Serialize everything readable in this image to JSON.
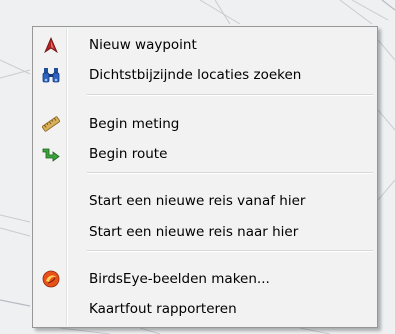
{
  "menu": {
    "items": [
      {
        "label": "Nieuw waypoint",
        "icon": "waypoint-pin-icon"
      },
      {
        "label": "Dichtstbijzijnde locaties zoeken",
        "icon": "binoculars-icon"
      },
      {
        "label": "Begin meting",
        "icon": "ruler-icon"
      },
      {
        "label": "Begin route",
        "icon": "route-arrow-icon"
      },
      {
        "label": "Start een nieuwe reis vanaf hier",
        "icon": ""
      },
      {
        "label": "Start een nieuwe reis naar hier",
        "icon": ""
      },
      {
        "label": "BirdsEye-beelden maken...",
        "icon": "birdseye-icon"
      },
      {
        "label": "Kaartfout rapporteren",
        "icon": ""
      }
    ]
  },
  "colors": {
    "menu_background": "#f2f2f2",
    "menu_border": "#979797",
    "waypoint_icon": "#b22222",
    "binoculars_icon": "#1f4e9c",
    "ruler_icon": "#c8a04a",
    "route_icon": "#2e8b2e",
    "birdseye_icon": "#e8501a"
  }
}
